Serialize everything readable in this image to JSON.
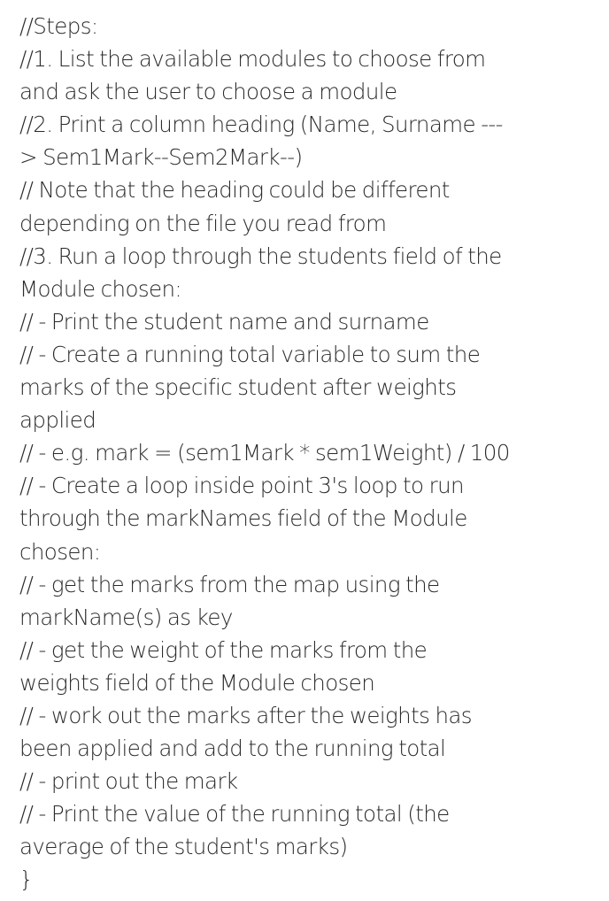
{
  "document": {
    "lines": [
      "//Steps:",
      "//1. List the available modules to choose from",
      "and ask the user to choose a module",
      "//2. Print a column heading (Name, Surname ---",
      "> Sem1Mark--Sem2Mark--)",
      "// Note that the heading could be different",
      "depending on the file you read from",
      "//3. Run a loop through the students field of the",
      "Module chosen:",
      "// - Print the student name and surname",
      "// - Create a running total variable to sum the",
      "marks of the specific student after weights",
      "applied",
      "// - e.g. mark = (sem1Mark * sem1Weight) / 100",
      "// - Create a loop inside point 3's loop to run",
      "through the markNames field of the Module",
      "chosen:",
      "// - get the marks from the map using the",
      "markName(s) as key",
      "// - get the weight of the marks from the",
      "weights field of the Module chosen",
      "// - work out the marks after the weights has",
      "been applied and add to the running total",
      "// - print out the mark",
      "// - Print the value of the running total (the",
      "average of the student's marks)",
      "}"
    ]
  }
}
